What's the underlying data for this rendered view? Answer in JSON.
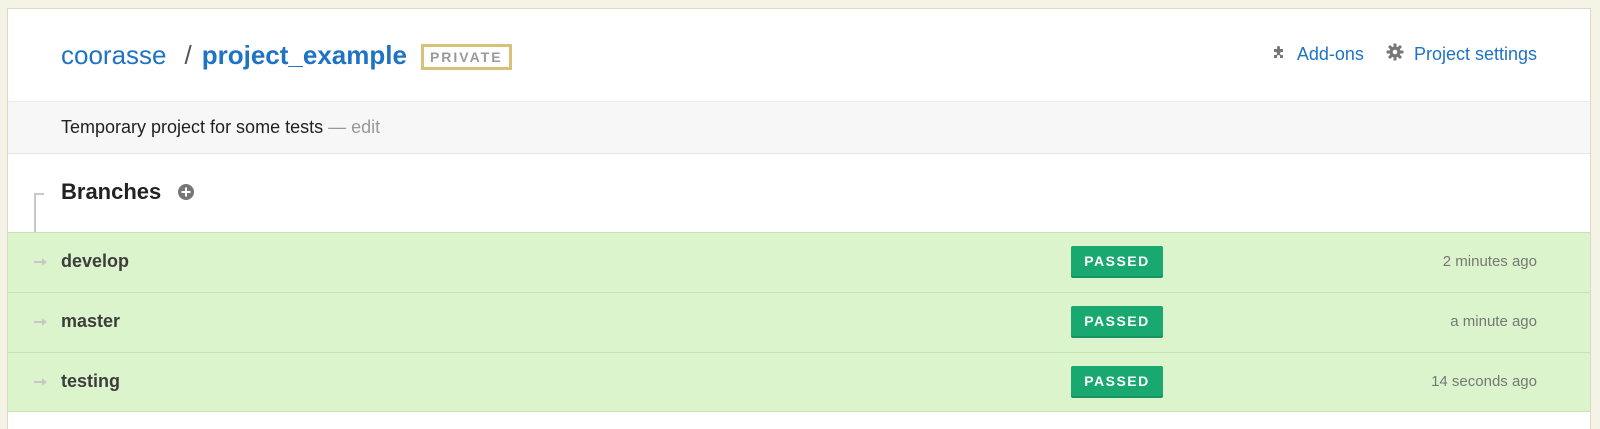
{
  "header": {
    "owner": "coorasse",
    "separator": "/",
    "project": "project_example",
    "visibility_badge": "PRIVATE",
    "links": [
      {
        "label": "Add-ons",
        "icon": "puzzle-icon"
      },
      {
        "label": "Project settings",
        "icon": "gear-icon"
      }
    ]
  },
  "description": {
    "text": "Temporary project for some tests",
    "edit": "— edit"
  },
  "branches": {
    "title": "Branches",
    "add_icon": "plus-circle-icon",
    "items": [
      {
        "name": "develop",
        "status": "PASSED",
        "time": "2 minutes ago"
      },
      {
        "name": "master",
        "status": "PASSED",
        "time": "a minute ago"
      },
      {
        "name": "testing",
        "status": "PASSED",
        "time": "14 seconds ago"
      }
    ]
  },
  "colors": {
    "link": "#1f73c4",
    "passed_bg": "#19a86f",
    "row_bg": "#dcf4cb",
    "private_border": "#d8c27a"
  }
}
